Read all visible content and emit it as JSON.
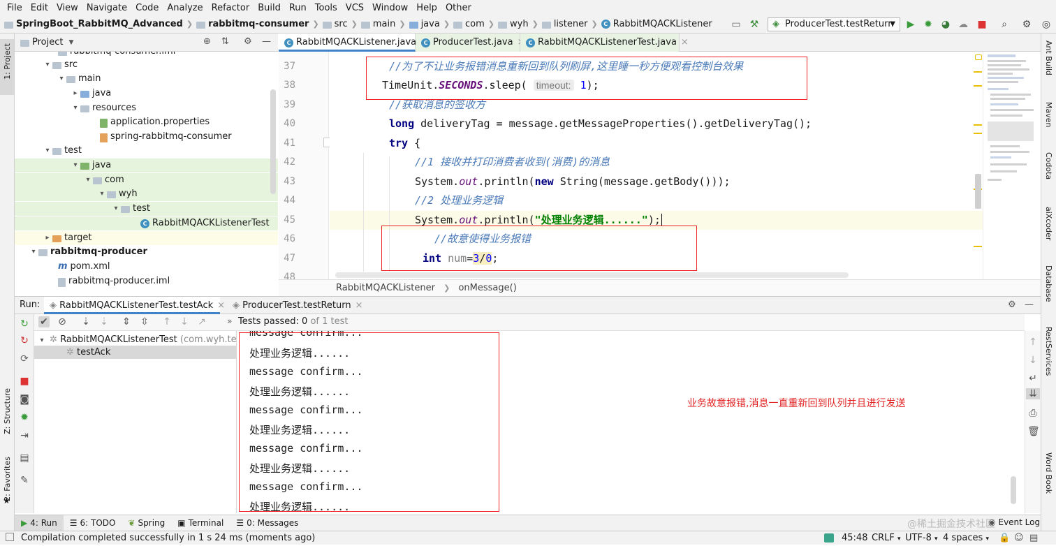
{
  "menu": [
    "File",
    "Edit",
    "View",
    "Navigate",
    "Code",
    "Analyze",
    "Refactor",
    "Build",
    "Run",
    "Tools",
    "VCS",
    "Window",
    "Help",
    "Other"
  ],
  "breadcrumb": [
    "SpringBoot_RabbitMQ_Advanced",
    "rabbitmq-consumer",
    "src",
    "main",
    "java",
    "com",
    "wyh",
    "listener",
    "RabbitMQACKListener"
  ],
  "run_config": "ProducerTest.testReturn",
  "project_panel": {
    "title": "Project",
    "tree": [
      {
        "label": "rabbitmq-consumer.iml"
      },
      {
        "label": "src"
      },
      {
        "label": "main"
      },
      {
        "label": "java"
      },
      {
        "label": "resources"
      },
      {
        "label": "application.properties"
      },
      {
        "label": "spring-rabbitmq-consumer"
      },
      {
        "label": "test"
      },
      {
        "label": "java"
      },
      {
        "label": "com"
      },
      {
        "label": "wyh"
      },
      {
        "label": "test"
      },
      {
        "label": "RabbitMQACKListenerTest"
      },
      {
        "label": "target"
      },
      {
        "label": "rabbitmq-producer"
      },
      {
        "label": "pom.xml"
      },
      {
        "label": "rabbitmq-producer.iml"
      }
    ]
  },
  "left_strip": {
    "project": "1: Project",
    "structure": "Z: Structure",
    "favorites": "2: Favorites"
  },
  "right_strip": [
    "Ant Build",
    "Maven",
    "Codota",
    "aiXcoder",
    "Database",
    "RestServices",
    "Word Book"
  ],
  "editor_tabs": [
    "RabbitMQACKListener.java",
    "ProducerTest.java",
    "RabbitMQACKListenerTest.java"
  ],
  "code": {
    "line_numbers": [
      "37",
      "38",
      "39",
      "40",
      "41",
      "42",
      "43",
      "44",
      "45",
      "46",
      "47",
      "48"
    ],
    "l37": "//为了不让业务报错消息重新回到队列刷屏,这里睡一秒方便观看控制台效果",
    "l38_cls": "TimeUnit.",
    "l38_fld": "SECONDS",
    "l38_mth": ".sleep(",
    "l38_hint": "timeout:",
    "l38_num": "1",
    "l38_end": ");",
    "l39": "//获取消息的签收方",
    "l40_kw": "long",
    "l40_rest": " deliveryTag = message.getMessageProperties().getDeliveryTag();",
    "l41_kw": "try",
    "l41_rest": " {",
    "l42": "//1 接收并打印消费者收到(消费)的消息",
    "l43_a": "System.",
    "l43_fld": "out",
    "l43_b": ".println(",
    "l43_kw": "new",
    "l43_c": " String(message.getBody()));",
    "l44": "//2 处理业务逻辑",
    "l45_a": "System.",
    "l45_fld": "out",
    "l45_b": ".println(",
    "l45_str": "\"处理业务逻辑......\"",
    "l45_c": ");",
    "l46": "//故意使得业务报错",
    "l47_kw": "int",
    "l47_var": " num",
    "l47_eq": "=",
    "l47_n1": "3",
    "l47_op": "/",
    "l47_n2": "0",
    "l47_end": ";"
  },
  "editor_breadcrumb": [
    "RabbitMQACKListener",
    "onMessage()"
  ],
  "run_panel": {
    "label": "Run:",
    "tabs": [
      "RabbitMQACKListenerTest.testAck",
      "ProducerTest.testReturn"
    ],
    "tests_passed_label": "Tests passed:",
    "tests_passed_count": "0",
    "tests_passed_total": "of 1 test",
    "test_root": "RabbitMQACKListenerTest",
    "test_root_pkg": "(com.wyh.test)",
    "test_leaf": "testAck"
  },
  "console_lines": [
    "message confirm...",
    "处理业务逻辑......",
    "message confirm...",
    "处理业务逻辑......",
    "message confirm...",
    "处理业务逻辑......",
    "message confirm...",
    "处理业务逻辑......",
    "message confirm...",
    "处理业务逻辑......"
  ],
  "annotation": "业务故意报错,消息一直重新回到队列并且进行发送",
  "bottom_tabs": [
    "4: Run",
    "6: TODO",
    "Spring",
    "Terminal",
    "0: Messages"
  ],
  "event_log": "Event Log",
  "watermark": "@稀土掘金技术社区",
  "status": {
    "message": "Compilation completed successfully in 1 s 24 ms (moments ago)",
    "position": "45:48",
    "line_sep": "CRLF",
    "encoding": "UTF-8",
    "indent": "4 spaces"
  },
  "colors": {
    "annotation_red": "#e22222",
    "accent_blue": "#4083c9",
    "tree_highlight": "#e6f4dd"
  }
}
